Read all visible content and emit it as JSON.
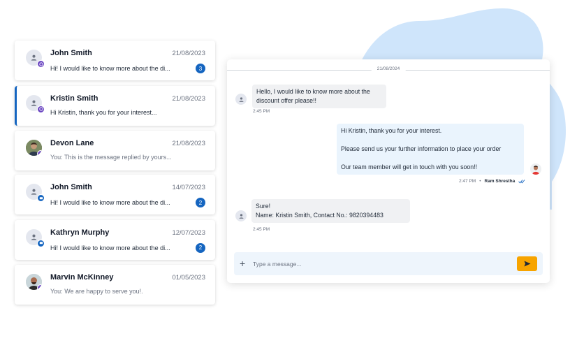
{
  "colors": {
    "accent": "#1565c0",
    "send_button": "#f7a400",
    "blob": "#cfe5fb",
    "outgoing_bubble": "#eaf4fd",
    "incoming_bubble": "#f0f1f3",
    "messenger_badge": "#6b46c1"
  },
  "conversations": [
    {
      "name": "John Smith",
      "date": "21/08/2023",
      "preview": "Hi! I would like to know more about the di...",
      "unread": "3",
      "channel_icon": "messenger-icon",
      "avatar": "user-icon"
    },
    {
      "name": "Kristin Smith",
      "date": "21/08/2023",
      "preview": "Hi Kristin, thank you for your interest...",
      "unread": "",
      "channel_icon": "messenger-icon",
      "avatar": "user-icon",
      "active": true
    },
    {
      "name": "Devon Lane",
      "date": "21/08/2023",
      "preview": "You: This is the message replied by yours...",
      "unread": "",
      "channel_icon": "messenger-icon",
      "avatar": "photo"
    },
    {
      "name": "John Smith",
      "date": "14/07/2023",
      "preview": "Hi! I would like to know more about the di...",
      "unread": "2",
      "channel_icon": "sms-icon",
      "avatar": "user-icon"
    },
    {
      "name": "Kathryn Murphy",
      "date": "12/07/2023",
      "preview": "Hi! I would like to know more about the di...",
      "unread": "2",
      "channel_icon": "sms-icon",
      "avatar": "user-icon"
    },
    {
      "name": "Marvin McKinney",
      "date": "01/05/2023",
      "preview": "You: We are happy to serve you!.",
      "unread": "",
      "channel_icon": "messenger-icon",
      "avatar": "photo"
    }
  ],
  "chat": {
    "date_divider": "21/08/2024",
    "messages": [
      {
        "direction": "in",
        "lines": [
          "Hello, I would like to know more about the",
          "discount offer please!!"
        ],
        "time": "2:45 PM"
      },
      {
        "direction": "out",
        "lines": [
          "Hi Kristin, thank you for your interest.",
          "Please send us your further information to place your order",
          "Our team member will get in touch with you soon!!"
        ],
        "time": "2:47 PM",
        "separator": "•",
        "agent": "Ram Shrestha",
        "status_icon": "double-check-icon"
      },
      {
        "direction": "in",
        "lines": [
          "Sure!",
          "Name: Kristin Smith, Contact No.: 9820394483"
        ],
        "time": "2:45 PM"
      }
    ],
    "composer": {
      "placeholder": "Type a message...",
      "value": "",
      "attach_icon": "plus-icon",
      "send_icon": "send-icon"
    }
  }
}
